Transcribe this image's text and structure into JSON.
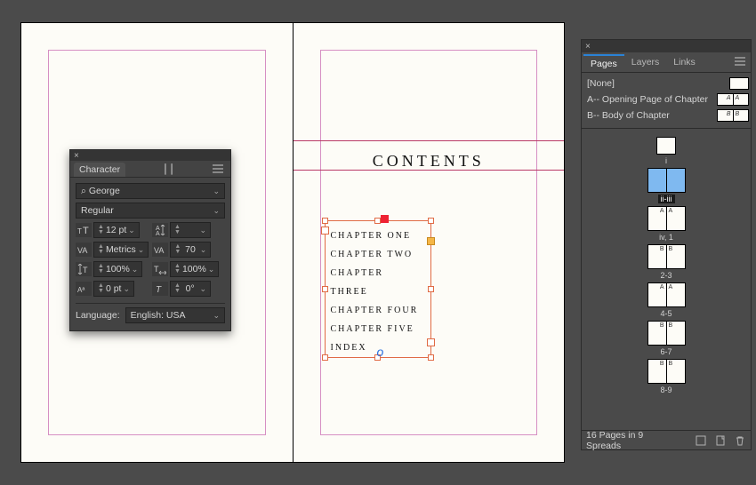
{
  "document": {
    "content_title": "CONTENTS",
    "toc": [
      "CHAPTER ONE",
      "CHAPTER TWO",
      "CHAPTER THREE",
      "CHAPTER FOUR",
      "CHAPTER FIVE",
      "",
      "INDEX"
    ]
  },
  "character_panel": {
    "title": "Character",
    "font_family": "George",
    "font_style": "Regular",
    "font_size": "12 pt",
    "leading": "",
    "kerning": "Metrics",
    "tracking": "70",
    "vscale": "100%",
    "hscale": "100%",
    "baseline": "0 pt",
    "skew": "0°",
    "language_label": "Language:",
    "language": "English: USA",
    "search_prefix": "⌕"
  },
  "pages_panel": {
    "tabs": [
      "Pages",
      "Layers",
      "Links"
    ],
    "masters": [
      {
        "label": "[None]",
        "double": false,
        "marks": []
      },
      {
        "label": "A-- Opening Page of Chapter",
        "double": true,
        "marks": [
          "A",
          "A"
        ]
      },
      {
        "label": "B-- Body of Chapter",
        "double": true,
        "marks": [
          "B",
          "B"
        ]
      }
    ],
    "spreads": [
      {
        "pages": [
          {
            "mark": "",
            "half": true
          }
        ],
        "label": "i",
        "selected": false
      },
      {
        "pages": [
          {
            "mark": ""
          },
          {
            "mark": ""
          }
        ],
        "label": "ii-iii",
        "selected": true
      },
      {
        "pages": [
          {
            "mark": "A",
            "side": "l"
          },
          {
            "mark": "A",
            "side": "r"
          }
        ],
        "label": "iv, 1",
        "selected": false
      },
      {
        "pages": [
          {
            "mark": "B",
            "side": "l"
          },
          {
            "mark": "B",
            "side": "r"
          }
        ],
        "label": "2-3",
        "selected": false
      },
      {
        "pages": [
          {
            "mark": "A",
            "side": "l"
          },
          {
            "mark": "A",
            "side": "r"
          }
        ],
        "label": "4-5",
        "selected": false
      },
      {
        "pages": [
          {
            "mark": "B",
            "side": "l"
          },
          {
            "mark": "B",
            "side": "r"
          }
        ],
        "label": "6-7",
        "selected": false
      },
      {
        "pages": [
          {
            "mark": "B",
            "side": "l"
          },
          {
            "mark": "B",
            "side": "r"
          }
        ],
        "label": "8-9",
        "selected": false
      }
    ],
    "footer_status": "16 Pages in 9 Spreads"
  }
}
